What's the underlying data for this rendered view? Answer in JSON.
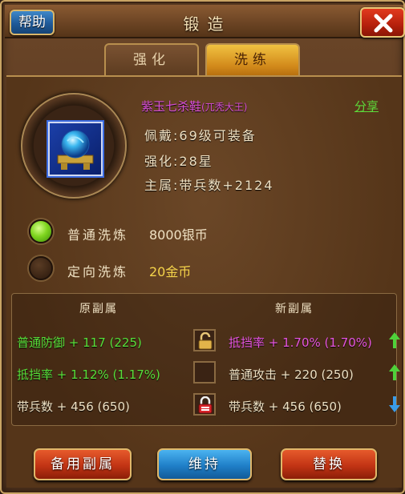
{
  "header": {
    "help_label": "帮助",
    "title": "锻造",
    "close_icon": "close-x-icon"
  },
  "tabs": [
    {
      "label": "强化",
      "active": false
    },
    {
      "label": "洗练",
      "active": true
    }
  ],
  "item": {
    "name": "紫玉七杀鞋",
    "owner": "(兀秃大王)",
    "share_label": "分享",
    "equip_level": "佩戴:69级可装备",
    "strengthen": "强化:28星",
    "main_attr": "主属:带兵数+2124",
    "icon": "blue-orb-icon"
  },
  "options": [
    {
      "label": "普通洗炼",
      "cost": "8000银币",
      "selected": true
    },
    {
      "label": "定向洗炼",
      "cost": "20金币",
      "selected": false
    }
  ],
  "attributes": {
    "old_header": "原副属",
    "new_header": "新副属",
    "rows": [
      {
        "old": "普通防御 + 117 (225)",
        "new": "抵挡率 + 1.70% (1.70%)",
        "lock": "unlocked",
        "trend": "up"
      },
      {
        "old": "抵挡率 + 1.12% (1.17%)",
        "new": "普通攻击 + 220 (250)",
        "lock": "empty",
        "trend": "up"
      },
      {
        "old": "带兵数 + 456 (650)",
        "new": "带兵数 + 456 (650)",
        "lock": "locked",
        "trend": "down"
      }
    ]
  },
  "buttons": {
    "backup": "备用副属",
    "keep": "维持",
    "replace": "替换"
  },
  "colors": {
    "green": "#58e03a",
    "magenta": "#e655e0",
    "gold": "#f4d34a"
  }
}
